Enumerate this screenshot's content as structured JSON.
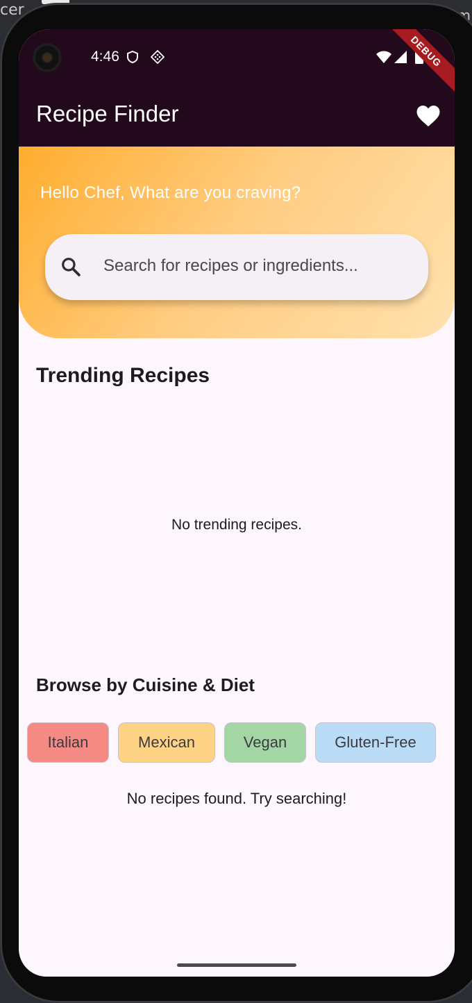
{
  "status_bar": {
    "time": "4:46",
    "debug_banner": "DEBUG",
    "icons": [
      "shield-icon",
      "diamond-grid-icon",
      "wifi-icon",
      "signal-icon",
      "battery-icon"
    ]
  },
  "app_bar": {
    "title": "Recipe Finder",
    "action_icon": "heart-icon"
  },
  "hero": {
    "greeting": "Hello Chef, What are you craving?",
    "search": {
      "placeholder": "Search for recipes or ingredients...",
      "value": "",
      "icon": "search-icon"
    },
    "gradient": [
      "#ffad2e",
      "#ffe1ad"
    ]
  },
  "trending": {
    "title": "Trending Recipes",
    "empty_message": "No trending recipes."
  },
  "browse": {
    "title": "Browse by Cuisine & Diet",
    "chips": [
      {
        "label": "Italian",
        "color": "#f48a83"
      },
      {
        "label": "Mexican",
        "color": "#fed385"
      },
      {
        "label": "Vegan",
        "color": "#a3d5a5"
      },
      {
        "label": "Gluten-Free",
        "color": "#bbdcf7"
      }
    ]
  },
  "results": {
    "empty_message": "No recipes found. Try searching!"
  },
  "colors": {
    "app_bar": "#22091b",
    "background": "#fdf6fd"
  }
}
